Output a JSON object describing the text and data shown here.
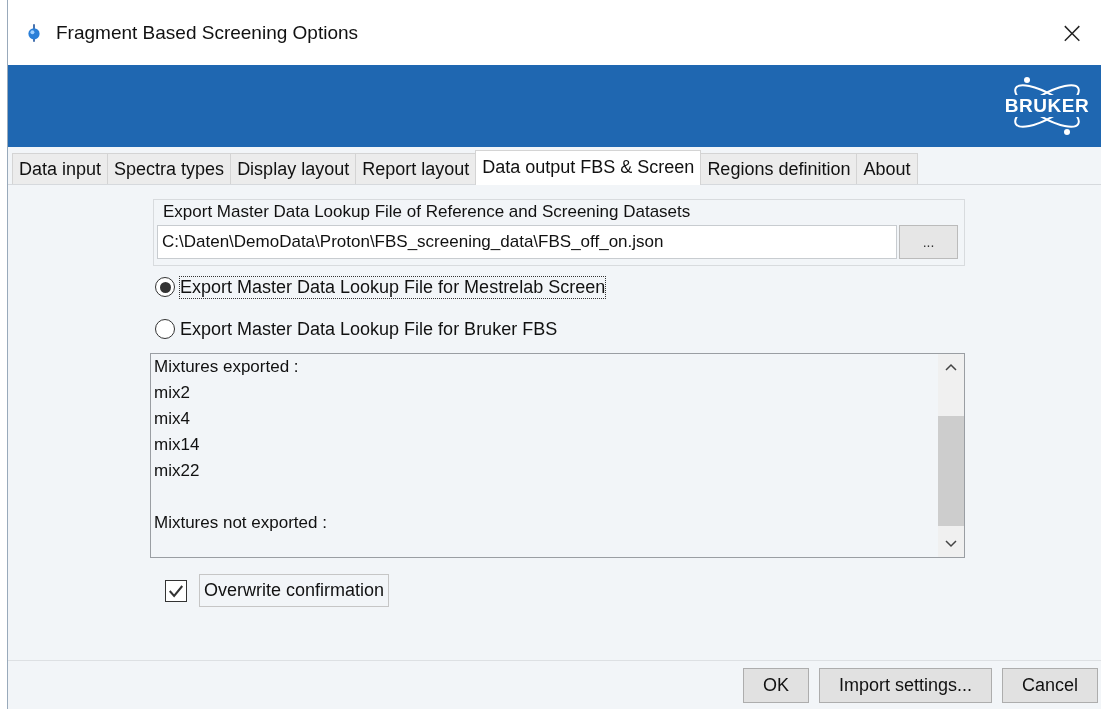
{
  "window": {
    "title": "Fragment Based Screening Options",
    "close": "×"
  },
  "banner": {
    "logo": "BRUKER"
  },
  "tabs": [
    {
      "label": "Data input",
      "selected": false
    },
    {
      "label": "Spectra types",
      "selected": false
    },
    {
      "label": "Display layout",
      "selected": false
    },
    {
      "label": "Report layout",
      "selected": false
    },
    {
      "label": "Data output FBS & Screen",
      "selected": true
    },
    {
      "label": "Regions definition",
      "selected": false
    },
    {
      "label": "About",
      "selected": false
    }
  ],
  "export_group": {
    "title": "Export Master Data Lookup File of Reference and Screening Datasets",
    "path": "C:\\Daten\\DemoData\\Proton\\FBS_screening_data\\FBS_off_on.json",
    "browse": "..."
  },
  "radios": [
    {
      "label": "Export Master Data Lookup File for Mestrelab Screen",
      "selected": true,
      "focused": true
    },
    {
      "label": "Export Master Data Lookup File for Bruker FBS",
      "selected": false,
      "focused": false
    }
  ],
  "log": {
    "sections": [
      {
        "heading": "Mixtures exported :",
        "items": [
          "mix2",
          "mix4",
          "mix14",
          "mix22"
        ]
      },
      {
        "heading": "Mixtures not exported :"
      }
    ]
  },
  "overwrite": {
    "label": "Overwrite confirmation",
    "checked": true
  },
  "buttons": [
    "OK",
    "Import settings...",
    "Cancel"
  ]
}
